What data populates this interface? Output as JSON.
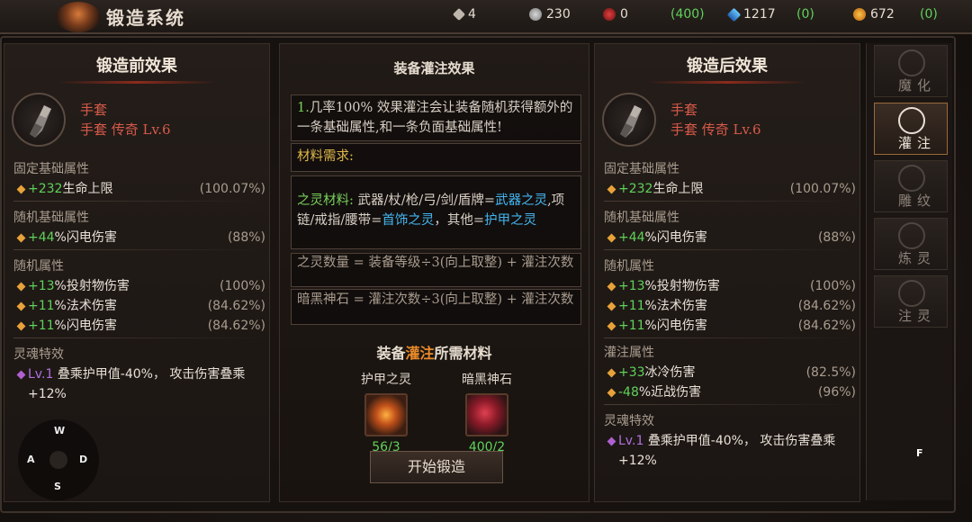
{
  "header": {
    "title": "锻造系统",
    "resources": [
      {
        "icon": "gem-icon",
        "value": "4"
      },
      {
        "icon": "silver-coin-icon",
        "value": "230"
      },
      {
        "icon": "red-crystal-icon",
        "value": "0"
      },
      {
        "icon": "",
        "value": "(400)",
        "green": true
      },
      {
        "icon": "blue-crystal-icon",
        "value": "1217"
      },
      {
        "icon": "",
        "value": "(0)",
        "green": true
      },
      {
        "icon": "gold-drop-icon",
        "value": "672"
      },
      {
        "icon": "",
        "value": "(0)",
        "green": true
      }
    ]
  },
  "left": {
    "title": "锻造前效果",
    "item_name": "手套",
    "item_sub": "手套 传奇 Lv.6",
    "fixed_title": "固定基础属性",
    "fixed": [
      {
        "val": "+232",
        "text": "生命上限",
        "pct": "(100.07%)"
      }
    ],
    "random_base_title": "随机基础属性",
    "random_base": [
      {
        "val": "+44",
        "text": "%闪电伤害",
        "pct": "(88%)"
      }
    ],
    "random_title": "随机属性",
    "random": [
      {
        "val": "+13",
        "text": "%投射物伤害",
        "pct": "(100%)"
      },
      {
        "val": "+11",
        "text": "%法术伤害",
        "pct": "(84.62%)"
      },
      {
        "val": "+11",
        "text": "%闪电伤害",
        "pct": "(84.62%)"
      }
    ],
    "soul_title": "灵魂特效",
    "soul_lv": "Lv.1",
    "soul_text": "叠乘护甲值-40%， 攻击伤害叠乘+12%"
  },
  "middle": {
    "title": "装备灌注效果",
    "effect_num": "1.",
    "effect_text": "几率100% 效果灌注会让装备随机获得额外的一条基础属性,和一条负面基础属性!",
    "materials_label": "材料需求:",
    "spirit_label": "之灵材料:",
    "spirit_a": " 武器/杖/枪/弓/剑/盾牌=",
    "spirit_weapon": "武器之灵",
    "spirit_b": ",项链/戒指/腰带=",
    "spirit_jewel": "首饰之灵",
    "spirit_c": "，其他=",
    "spirit_armor": "护甲之灵",
    "formula1": "之灵数量 = 装备等级÷3(向上取整) + 灌注次数",
    "formula2": "暗黑神石 = 灌注次数÷3(向上取整) + 灌注次数",
    "need_a": "装备",
    "need_b": "灌注",
    "need_c": "所需材料",
    "mat1_name": "护甲之灵",
    "mat1_count": "56/3",
    "mat2_name": "暗黑神石",
    "mat2_count": "400/2",
    "start_button": "开始锻造"
  },
  "right": {
    "title": "锻造后效果",
    "item_name": "手套",
    "item_sub": "手套 传奇 Lv.6",
    "fixed_title": "固定基础属性",
    "fixed": [
      {
        "val": "+232",
        "text": "生命上限",
        "pct": "(100.07%)"
      }
    ],
    "random_base_title": "随机基础属性",
    "random_base": [
      {
        "val": "+44",
        "text": "%闪电伤害",
        "pct": "(88%)"
      }
    ],
    "random_title": "随机属性",
    "random": [
      {
        "val": "+13",
        "text": "%投射物伤害",
        "pct": "(100%)"
      },
      {
        "val": "+11",
        "text": "%法术伤害",
        "pct": "(84.62%)"
      },
      {
        "val": "+11",
        "text": "%闪电伤害",
        "pct": "(84.62%)"
      }
    ],
    "infuse_title": "灌注属性",
    "infuse": [
      {
        "val": "+33",
        "text": "冰冷伤害",
        "pct": "(82.5%)"
      },
      {
        "val": "-48",
        "text": "%近战伤害",
        "pct": "(96%)"
      }
    ],
    "soul_title": "灵魂特效",
    "soul_lv": "Lv.1",
    "soul_text": "叠乘护甲值-40%， 攻击伤害叠乘+12%"
  },
  "nav": [
    {
      "label": "魔化",
      "icon": "demon-skull-icon",
      "active": false
    },
    {
      "label": "灌注",
      "icon": "infusion-rune-icon",
      "active": true
    },
    {
      "label": "雕纹",
      "icon": "engrave-icon",
      "active": false
    },
    {
      "label": "炼灵",
      "icon": "spirit-hands-icon",
      "active": false
    },
    {
      "label": "注灵",
      "icon": "soul-inject-icon",
      "active": false
    }
  ],
  "controls": {
    "w": "W",
    "a": "A",
    "s": "S",
    "d": "D",
    "f": "F"
  }
}
